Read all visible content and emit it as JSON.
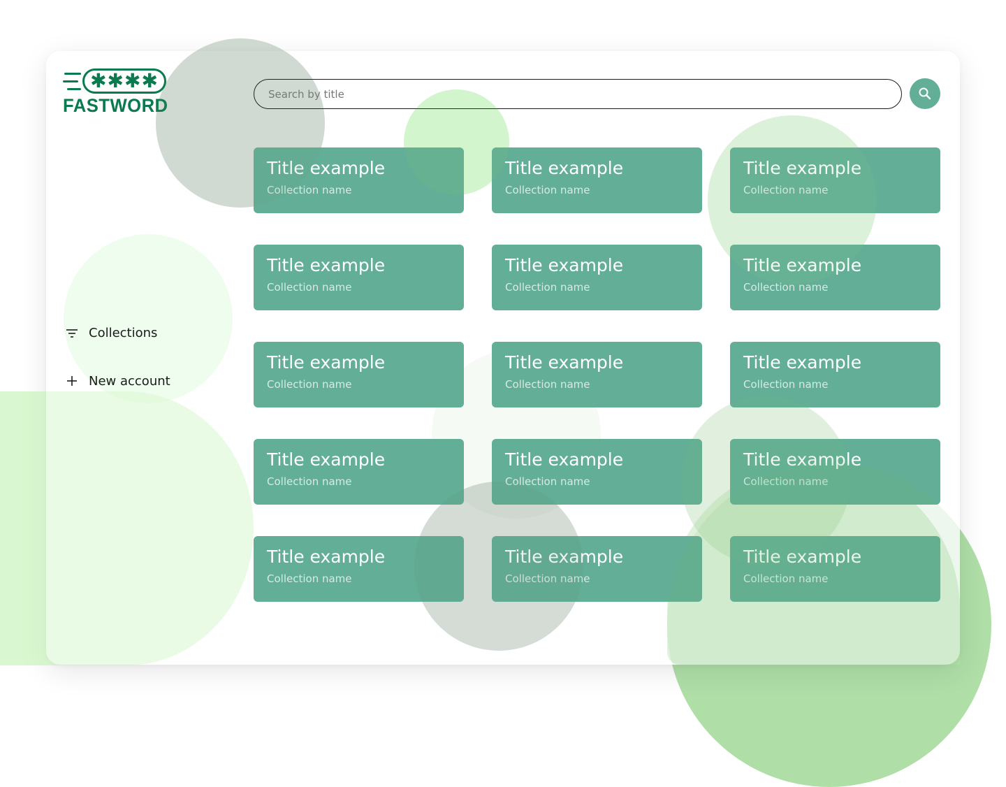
{
  "brand": {
    "logo_stars": "✱✱✱✱",
    "logo_text": "FASTWORD",
    "color": "#0b7a4f"
  },
  "search": {
    "placeholder": "Search by title",
    "button_icon": "search-icon"
  },
  "sidebar": {
    "items": [
      {
        "label": "Collections",
        "icon": "filter-icon"
      },
      {
        "label": "New account",
        "icon": "plus-icon"
      }
    ]
  },
  "cards": [
    {
      "title": "Title example",
      "collection": "Collection name"
    },
    {
      "title": "Title example",
      "collection": "Collection name"
    },
    {
      "title": "Title example",
      "collection": "Collection name"
    },
    {
      "title": "Title example",
      "collection": "Collection name"
    },
    {
      "title": "Title example",
      "collection": "Collection name"
    },
    {
      "title": "Title example",
      "collection": "Collection name"
    },
    {
      "title": "Title example",
      "collection": "Collection name"
    },
    {
      "title": "Title example",
      "collection": "Collection name"
    },
    {
      "title": "Title example",
      "collection": "Collection name"
    },
    {
      "title": "Title example",
      "collection": "Collection name"
    },
    {
      "title": "Title example",
      "collection": "Collection name"
    },
    {
      "title": "Title example",
      "collection": "Collection name"
    },
    {
      "title": "Title example",
      "collection": "Collection name"
    },
    {
      "title": "Title example",
      "collection": "Collection name"
    },
    {
      "title": "Title example",
      "collection": "Collection name"
    }
  ],
  "colors": {
    "card": "#63ae96",
    "accent": "#63ae96",
    "text": "#1a1a1a"
  }
}
